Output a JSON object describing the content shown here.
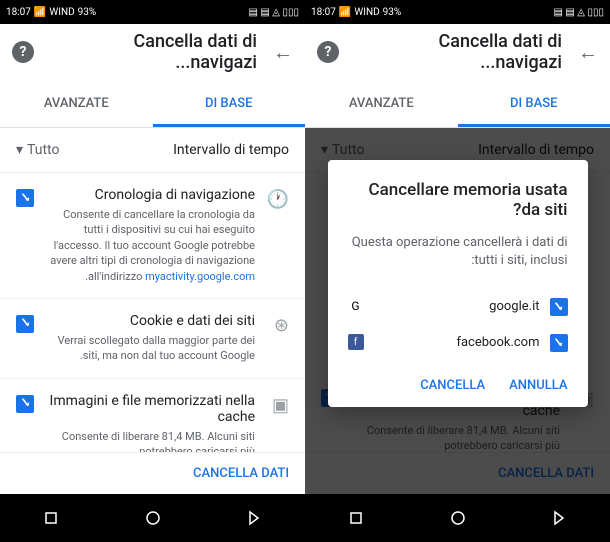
{
  "status": {
    "time": "18:07",
    "carrier": "WIND",
    "battery": "93%"
  },
  "header": {
    "title": "Cancella dati di navigazi..."
  },
  "tabs": {
    "basic": "DI BASE",
    "advanced": "AVANZATE"
  },
  "timeRange": {
    "label": "Intervallo di tempo",
    "value": "Tutto"
  },
  "options": {
    "history": {
      "title": "Cronologia di navigazione",
      "desc1": "Consente di cancellare la cronologia da tutti i dispositivi su cui hai eseguito l'accesso. Il tuo account Google potrebbe avere altri tipi di cronologia di navigazione all'indirizzo ",
      "link": "myactivity.google.com",
      "desc2": "."
    },
    "cookies": {
      "title": "Cookie e dati dei siti",
      "desc": "Verrai scollegato dalla maggior parte dei siti, ma non dal tuo account Google."
    },
    "cache": {
      "title": "Immagini e file memorizzati nella cache",
      "desc": "Consente di liberare 81,4 MB. Alcuni siti potrebbero caricarsi più"
    }
  },
  "footer": {
    "clearData": "CANCELLA DATI"
  },
  "dialog": {
    "title": "Cancellare memoria usata da siti?",
    "message": "Questa operazione cancellerà i dati di tutti i siti, inclusi:",
    "sites": {
      "google": "google.it",
      "facebook": "facebook.com"
    },
    "cancel": "ANNULLA",
    "confirm": "CANCELLA"
  }
}
